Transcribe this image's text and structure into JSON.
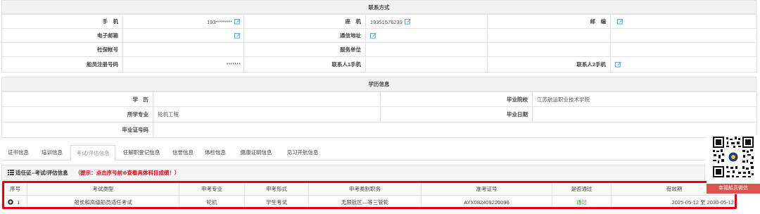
{
  "contact": {
    "title": "联系方式",
    "row1": {
      "l1": "手　机",
      "v1": "193********",
      "l2": "座　机",
      "v2": "19351576239",
      "l3": "邮　编",
      "v3": ""
    },
    "row2": {
      "l1": "电子邮箱",
      "v1": "",
      "l2": "通信地址",
      "v2": "",
      "l3": "",
      "v3": ""
    },
    "row3": {
      "l1": "社保帐号",
      "v1": "",
      "l2": "服务单位",
      "v2": "",
      "l3": "",
      "v3": ""
    },
    "row4": {
      "l1": "船员注册号码",
      "v1": "*******",
      "l2": "联系人1手机",
      "v2": "",
      "l3": "联系人2手机",
      "v3": ""
    }
  },
  "education": {
    "title": "学历信息",
    "row1": {
      "l1": "学　历",
      "v1": "",
      "l2": "毕业院校",
      "v2": "江苏航运职业技术学院"
    },
    "row2": {
      "l1": "所学专业",
      "v1": "轮机工程",
      "l2": "毕业日期",
      "v2": ""
    },
    "row3": {
      "l1": "毕业证号码",
      "v1": ""
    }
  },
  "tabs": [
    "证书信息",
    "培训信息",
    "考试/评估信息",
    "任解职登记信息",
    "信誉信息",
    "体检信息",
    "健康证明信息",
    "见习开航信息"
  ],
  "active_tab": 2,
  "panel": {
    "icon": "list-icon",
    "title": "适任证--考试/评估信息",
    "tip": "（提示：点击序号前⊕查看具体科目成绩！）"
  },
  "exam_table": {
    "headers": [
      "序号",
      "考试类型",
      "申考专业",
      "申考形式",
      "申考类别职务",
      "准考证号",
      "是否通过",
      "有效期"
    ],
    "rows": [
      {
        "no": "1",
        "type": "船长和高级船员适任考试",
        "major": "轮机",
        "form": "学生考试",
        "category": "无限航区—等三管轮",
        "ticket": "AYX082409220096",
        "passed": "通过",
        "valid": "2025-05-12 至 2030-05-12"
      }
    ]
  },
  "qr": {
    "caption": "幸福船员微信"
  },
  "colors": {
    "accent": "#2a9fd6",
    "red": "#e60012",
    "pass": "#2e9e2e"
  }
}
